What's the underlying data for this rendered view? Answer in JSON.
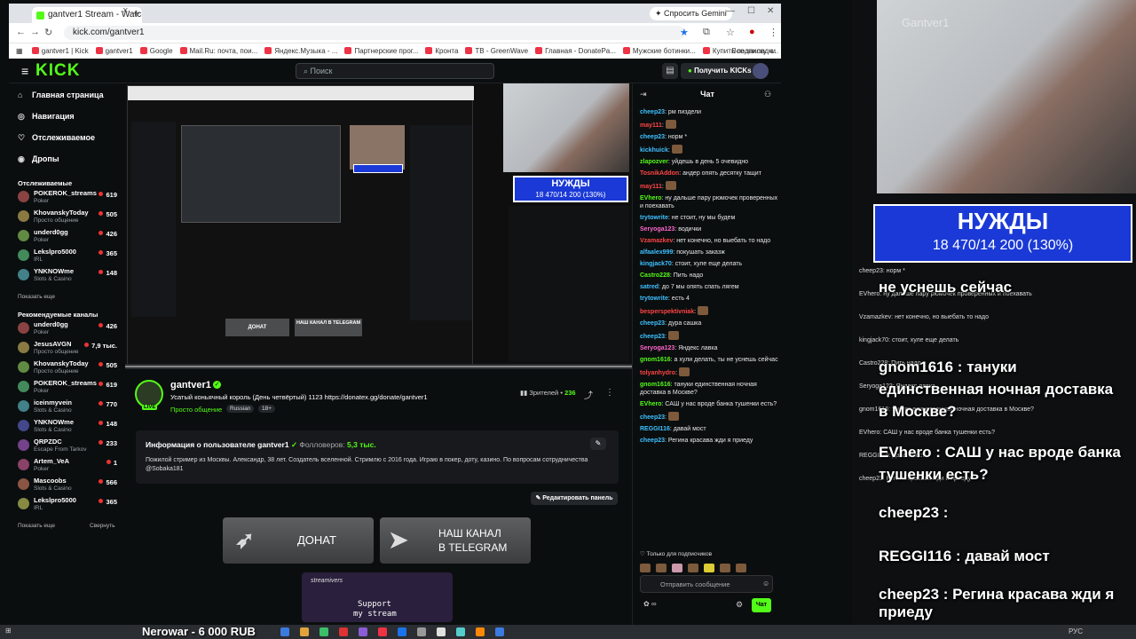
{
  "browser": {
    "tab_title": "gantver1 Stream - Watch Live o...",
    "tab_close": "×",
    "new_tab": "+",
    "gemini": "✦ Спросить Gemini",
    "url": "kick.com/gantver1",
    "bookmarks": [
      "gantver1 | Kick",
      "gantver1",
      "Google",
      "Mail.Ru: почта, пои...",
      "Яндекс.Музыка - ...",
      "Партнерские прог...",
      "Кронта",
      "TB - GreenWave",
      "Главная - DonatePa...",
      "Мужские ботинки...",
      "Купить подписку ч..."
    ],
    "all_bookmarks": "Все закладки"
  },
  "kick": {
    "logo": "KICK",
    "search_placeholder": "Поиск",
    "get_kicks": "Получить KICKs"
  },
  "sidebar": {
    "nav": [
      {
        "icon": "⌂",
        "label": "Главная страница"
      },
      {
        "icon": "◎",
        "label": "Навигация"
      },
      {
        "icon": "♡",
        "label": "Отслеживаемое"
      },
      {
        "icon": "◉",
        "label": "Дропы"
      }
    ],
    "followed_title": "Отслеживаемые",
    "followed": [
      {
        "name": "POKEROK_streams",
        "cat": "Poker",
        "viewers": "619"
      },
      {
        "name": "KhovanskyToday",
        "cat": "Просто общение",
        "viewers": "505"
      },
      {
        "name": "underd0gg",
        "cat": "Poker",
        "viewers": "426"
      },
      {
        "name": "Lekslpro5000",
        "cat": "IRL",
        "viewers": "365"
      },
      {
        "name": "YNKNOWme",
        "cat": "Slots & Casino",
        "viewers": "148"
      }
    ],
    "show_more": "Показать еще",
    "recommended_title": "Рекомендуемые каналы",
    "recommended": [
      {
        "name": "underd0gg",
        "cat": "Poker",
        "viewers": "426"
      },
      {
        "name": "JesusAVGN",
        "cat": "Просто общение",
        "viewers": "7,9 тыс."
      },
      {
        "name": "KhovanskyToday",
        "cat": "Просто общение",
        "viewers": "505"
      },
      {
        "name": "POKEROK_streams",
        "cat": "Poker",
        "viewers": "619"
      },
      {
        "name": "iceinmyvein",
        "cat": "Slots & Casino",
        "viewers": "770"
      },
      {
        "name": "YNKNOWme",
        "cat": "Slots & Casino",
        "viewers": "148"
      },
      {
        "name": "QRPZDC",
        "cat": "Escape From Tarkov",
        "viewers": "233"
      },
      {
        "name": "Artem_VeA",
        "cat": "Poker",
        "viewers": "1"
      },
      {
        "name": "Mascoobs",
        "cat": "Slots & Casino",
        "viewers": "566"
      },
      {
        "name": "Lekslpro5000",
        "cat": "IRL",
        "viewers": "365"
      }
    ],
    "show_more2": "Показать еще",
    "collapse": "Свернуть"
  },
  "video": {
    "nuzhdy_title": "НУЖДЫ",
    "nuzhdy_sub": "18 470/14 200 (130%)",
    "inner_donate": "ДОНАТ",
    "inner_tg": "НАШ КАНАЛ В TELEGRAM"
  },
  "stream": {
    "channel": "gantver1",
    "title": "Усатый коньячный король (День четвёртый) 1123 https://donatex.gg/donate/gantver1",
    "category": "Просто общение",
    "tag1": "Russian",
    "tag2": "18+",
    "viewers_label": "Зрителей •",
    "viewers": "236",
    "live": "LIVE"
  },
  "about": {
    "title": "Информация о пользователе gantver1",
    "followers_label": "Фолловеров:",
    "followers": "5,3 тыс.",
    "bio": "Пожилой стример из Москвы. Александр, 38 лет. Создатель вселенной. Стримлю с 2016 года. Играю в покер, доту, казино. По вопросам сотрудничества @Sobaka181",
    "edit_panel": "Редактировать панель",
    "donate": "ДОНАТ",
    "tg_line1": "НАШ КАНАЛ",
    "tg_line2": "В TELEGRAM",
    "support_brand": "streamivers",
    "support_line1": "Support",
    "support_line2": "my stream"
  },
  "chat": {
    "title": "Чат",
    "messages": [
      {
        "user": "cheep23",
        "color": "#3ec1ff",
        "text": "рм пиздели"
      },
      {
        "user": "may111",
        "color": "#ff4444",
        "text": ""
      },
      {
        "user": "cheep23",
        "color": "#3ec1ff",
        "text": "норм *"
      },
      {
        "user": "kickhuick",
        "color": "#3ec1ff",
        "text": ""
      },
      {
        "user": "zlapozver",
        "color": "#53fc18",
        "text": "уйдешь в день 5 очевидно"
      },
      {
        "user": "TosnikAddon",
        "color": "#ff4444",
        "text": "андер опять десятку тащит"
      },
      {
        "user": "may111",
        "color": "#ff4444",
        "text": ""
      },
      {
        "user": "EVhero",
        "color": "#53fc18",
        "text": "ну дальше пару рюмочек проверенных и поехавать"
      },
      {
        "user": "trytowrite",
        "color": "#3ec1ff",
        "text": "не стоит, ну мы будем"
      },
      {
        "user": "Seryoga123",
        "color": "#ff66cc",
        "text": "водички"
      },
      {
        "user": "Vzamazkev",
        "color": "#ff4444",
        "text": "нет конечно, но выебать то надо"
      },
      {
        "user": "alfaalex999",
        "color": "#3ec1ff",
        "text": "покушать заказж"
      },
      {
        "user": "kingjack70",
        "color": "#3ec1ff",
        "text": "стоит, хуле еще делать"
      },
      {
        "user": "Castro228",
        "color": "#53fc18",
        "text": "Пить надо"
      },
      {
        "user": "satred",
        "color": "#3ec1ff",
        "text": "до 7 мы опять спать лягем"
      },
      {
        "user": "trytowrite",
        "color": "#3ec1ff",
        "text": "есть 4"
      },
      {
        "user": "besperspektivniak",
        "color": "#ff4444",
        "text": ""
      },
      {
        "user": "cheep23",
        "color": "#3ec1ff",
        "text": "дура сашка"
      },
      {
        "user": "cheep23",
        "color": "#3ec1ff",
        "text": ""
      },
      {
        "user": "Seryoga123",
        "color": "#ff66cc",
        "text": "Яндекс лавка"
      },
      {
        "user": "gnom1616",
        "color": "#53fc18",
        "text": "а хули делать, ты не уснешь сейчас"
      },
      {
        "user": "tolyanhydro",
        "color": "#ff4444",
        "text": ""
      },
      {
        "user": "gnom1616",
        "color": "#53fc18",
        "text": "тануки единственная ночная доставка в Москве?"
      },
      {
        "user": "EVhero",
        "color": "#53fc18",
        "text": "САШ у нас вроде банка тушенки есть?"
      },
      {
        "user": "cheep23",
        "color": "#3ec1ff",
        "text": ""
      },
      {
        "user": "REGGI116",
        "color": "#3ec1ff",
        "text": "давай мост"
      },
      {
        "user": "cheep23",
        "color": "#3ec1ff",
        "text": "Регина красава жди я приеду"
      }
    ],
    "subs_only": "Только для подписчиков",
    "input_placeholder": "Отправить сообщение",
    "send": "Чат"
  },
  "overlay": {
    "nuzhdy_title": "НУЖДЫ",
    "nuzhdy_sub": "18 470/14 200 (130%)",
    "big_messages": [
      "не уснешь сейчас",
      "gnom1616 : тануки",
      "единственная ночная доставка",
      "в Москве?",
      "EVhero : САШ у нас вроде банка",
      "тушенки есть?",
      "cheep23 :",
      "REGGI116 : давай мост",
      "cheep23 : Регина красава жди я",
      "приеду"
    ],
    "small_messages": [
      "cheep23: норм *",
      "EVhero: ну дальше пару рюмочек проверенных и поехавать",
      "Vzamazkev: нет конечно, но выебать то надо",
      "kingjack70: стоит, хуле еще делать",
      "Castro228: Пить надо",
      "Seryoga123: Яндекс лавка",
      "gnom1616: тануки единственная ночная доставка в Москве?",
      "EVhero: САШ у нас вроде банка тушенки есть?",
      "REGGI116: давай мост",
      "cheep23: Регина красава жди я приеду"
    ],
    "watermark": "Gantver1"
  },
  "taskbar": {
    "ticker": "Nerowar - 6 000 RUB",
    "lang": "РУС"
  }
}
